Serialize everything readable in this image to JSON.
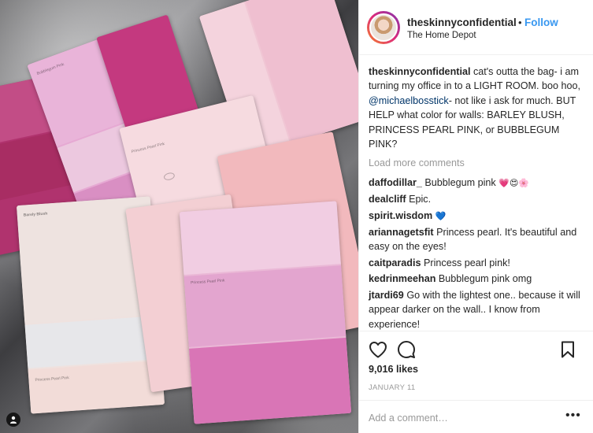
{
  "post": {
    "username": "theskinnyconfidential",
    "separator": "•",
    "follow_label": "Follow",
    "location": "The Home Depot",
    "caption": {
      "username": "theskinnyconfidential",
      "text_before_mention": "cat's outta the bag- i am turning my office in to a LIGHT ROOM. boo hoo, ",
      "mention": "@michaelbosstick",
      "text_after_mention": "- not like i ask for much. BUT HELP what color for walls: BARLEY BLUSH, PRINCESS PEARL PINK, or BUBBLEGUM PINK?"
    },
    "load_more_label": "Load more comments",
    "comments": [
      {
        "username": "daffodillar_",
        "text": "Bubblegum pink",
        "emoji": "💗😍🌸"
      },
      {
        "username": "dealcliff",
        "text": "Epic.",
        "emoji": ""
      },
      {
        "username": "spirit.wisdom",
        "text": "",
        "emoji": "💙"
      },
      {
        "username": "ariannagetsfit",
        "text": "Princess pearl. It's beautiful and easy on the eyes!",
        "emoji": ""
      },
      {
        "username": "caitparadis",
        "text": "Princess pearl pink!",
        "emoji": ""
      },
      {
        "username": "kedrinmeehan",
        "text": "Bubblegum pink omg",
        "emoji": ""
      },
      {
        "username": "jtardi69",
        "text": "Go with the lightest one.. because it will appear darker on the wall.. I know from experience!",
        "emoji": ""
      }
    ],
    "likes": "9,016 likes",
    "date": "JANUARY 11",
    "add_comment_placeholder": "Add a comment…",
    "more_label": "•••"
  },
  "photo": {
    "swatch_labels": [
      "Bubblegum Pink",
      "Princess Pearl Pink",
      "Barely Blush",
      "Princess Pearl Pink",
      "Princess Pearl Pink"
    ]
  },
  "icons": {
    "like": "heart-icon",
    "comment": "comment-icon",
    "save": "bookmark-icon",
    "photo_user": "user-icon"
  },
  "colors": {
    "follow": "#3897f0",
    "mention": "#003569",
    "muted": "#999999"
  }
}
